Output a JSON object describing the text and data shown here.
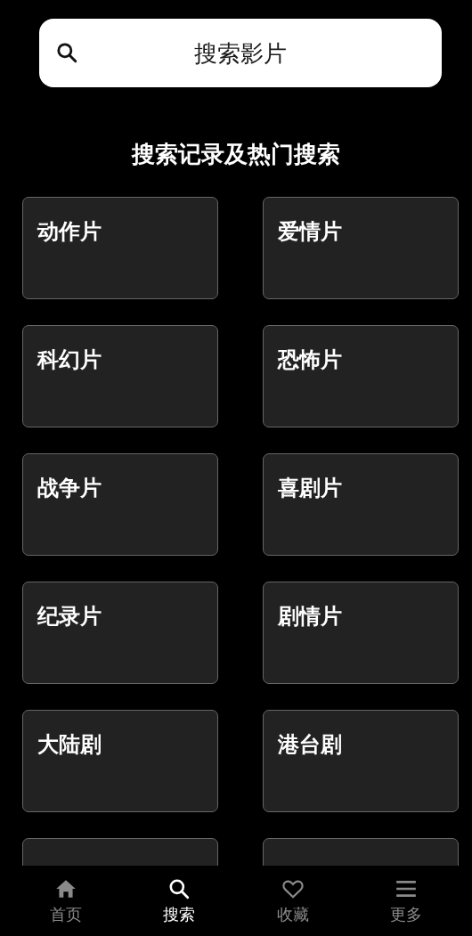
{
  "search": {
    "placeholder": "搜索影片"
  },
  "section_title": "搜索记录及热门搜索",
  "categories": [
    {
      "kind": "full",
      "label": "动作片"
    },
    {
      "kind": "full",
      "label": "爱情片"
    },
    {
      "kind": "full",
      "label": "科幻片"
    },
    {
      "kind": "full",
      "label": "恐怖片"
    },
    {
      "kind": "full",
      "label": "战争片"
    },
    {
      "kind": "full",
      "label": "喜剧片"
    },
    {
      "kind": "full",
      "label": "纪录片"
    },
    {
      "kind": "full",
      "label": "剧情片"
    },
    {
      "kind": "full",
      "label": "大陆剧"
    },
    {
      "kind": "full",
      "label": "港台剧"
    },
    {
      "kind": "cut"
    },
    {
      "kind": "cut"
    }
  ],
  "bottom_nav": [
    {
      "kind": "home",
      "label": "首页",
      "selected": false
    },
    {
      "kind": "search",
      "label": "搜索",
      "selected": true
    },
    {
      "kind": "favorites",
      "label": "收藏",
      "selected": false
    },
    {
      "kind": "more",
      "label": "更多",
      "selected": false
    }
  ]
}
